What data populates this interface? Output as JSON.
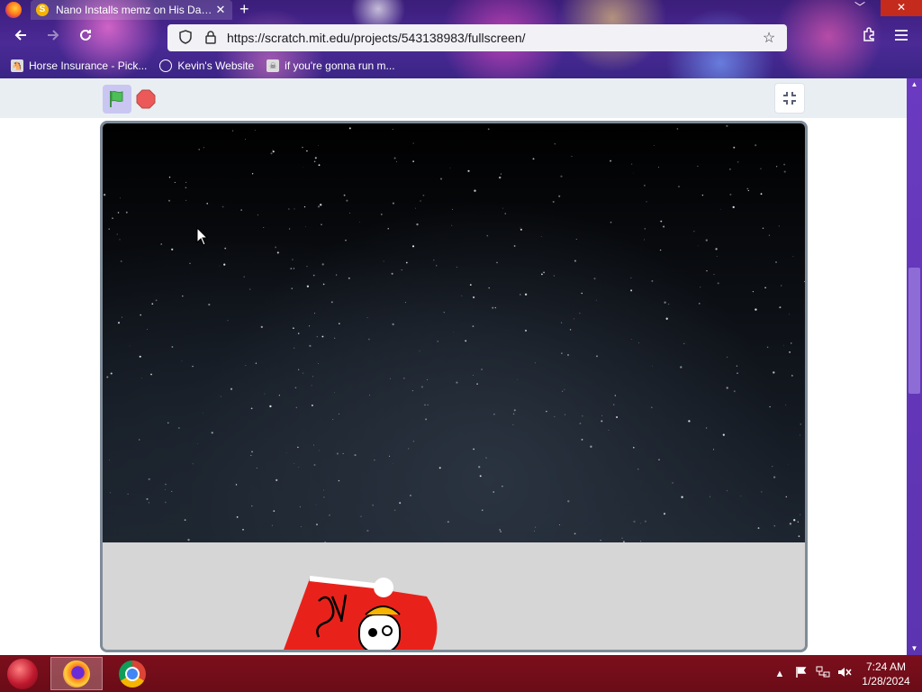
{
  "browser": {
    "tab_title": "Nano Installs memz on His Dad...",
    "tab_close_glyph": "✕",
    "new_tab_glyph": "+",
    "window_controls": {
      "minimize": "﹀",
      "close": "✕"
    },
    "url": "https://scratch.mit.edu/projects/543138983/fullscreen/",
    "bookmarks": [
      {
        "label": "Horse Insurance - Pick...",
        "icon": "horse-insurance-icon"
      },
      {
        "label": "Kevin's Website",
        "icon": "globe-icon"
      },
      {
        "label": "if you're gonna run m...",
        "icon": "skull-icon"
      }
    ]
  },
  "scratch_player": {
    "green_flag_icon": "green-flag-icon",
    "stop_icon": "stop-sign-icon",
    "exit_fullscreen_icon": "exit-fullscreen-icon",
    "stage": {
      "background": "starry-night-sky",
      "ground_color": "#d6d6d6"
    }
  },
  "taskbar": {
    "apps": [
      {
        "name": "Firefox",
        "icon": "firefox-icon",
        "active": true
      },
      {
        "name": "Google Chrome",
        "icon": "chrome-icon",
        "active": false
      }
    ],
    "tray_icons": [
      "show-hidden-icons-icon",
      "flag-icon",
      "network-icon",
      "volume-muted-icon"
    ],
    "time": "7:24 AM",
    "date": "1/28/2024"
  },
  "colors": {
    "taskbar": "#6a0c17",
    "browser_accent": "#4b2a96",
    "green_flag": "#4cbf56",
    "stop": "#ec5959"
  }
}
